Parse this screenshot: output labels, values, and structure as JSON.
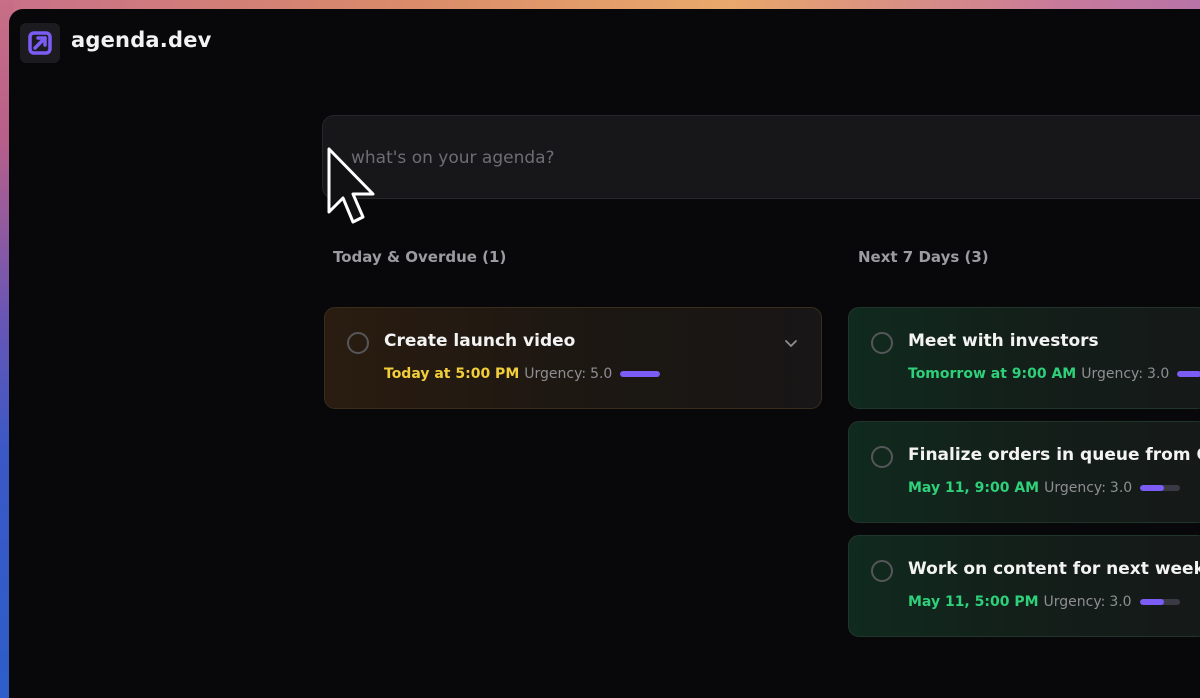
{
  "app": {
    "name": "agenda.dev",
    "accent": "#7b5cf5"
  },
  "search": {
    "placeholder": "what's on your agenda?",
    "value": ""
  },
  "sections": {
    "today": {
      "title": "Today & Overdue (1)",
      "tasks": [
        {
          "title": "Create launch video",
          "due": "Today at 5:00 PM",
          "urgency_label": "Urgency:",
          "urgency": "5.0",
          "urgency_fraction": 1.0,
          "due_color": "#f2cf3a"
        }
      ]
    },
    "next7": {
      "title": "Next 7 Days (3)",
      "tasks": [
        {
          "title": "Meet with investors",
          "due": "Tomorrow at 9:00 AM",
          "urgency_label": "Urgency:",
          "urgency": "3.0",
          "urgency_fraction": 0.6,
          "due_color": "#2fd07a"
        },
        {
          "title": "Finalize orders in queue from Github",
          "due": "May 11, 9:00 AM",
          "urgency_label": "Urgency:",
          "urgency": "3.0",
          "urgency_fraction": 0.6,
          "due_color": "#2fd07a"
        },
        {
          "title": "Work on content for next week",
          "due": "May 11, 5:00 PM",
          "urgency_label": "Urgency:",
          "urgency": "3.0",
          "urgency_fraction": 0.6,
          "due_color": "#2fd07a"
        }
      ]
    }
  },
  "icons": {
    "logo": "agenda-logo-icon",
    "expand": "chevron-down-icon",
    "checkbox": "circle-checkbox-icon",
    "cursor": "mouse-pointer-icon"
  }
}
